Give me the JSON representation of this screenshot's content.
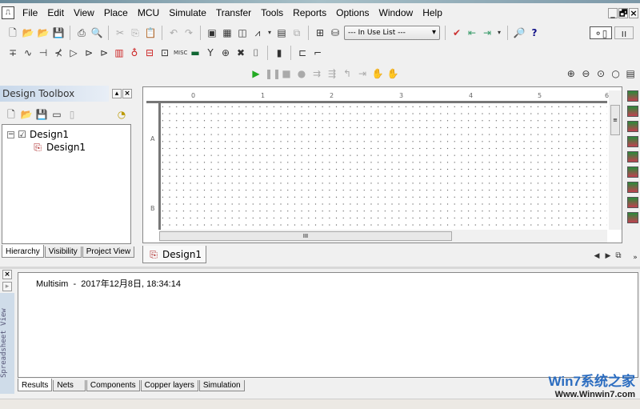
{
  "menu": [
    "File",
    "Edit",
    "View",
    "Place",
    "MCU",
    "Simulate",
    "Transfer",
    "Tools",
    "Reports",
    "Options",
    "Window",
    "Help"
  ],
  "window_controls": {
    "minimize": "_",
    "restore": "🗗",
    "close": "×"
  },
  "toolbar": {
    "in_use_list": "--- In Use List ---",
    "help": "?"
  },
  "components_toolbar": {
    "misc": "MISC"
  },
  "design_toolbox": {
    "title": "Design Toolbox",
    "tree": {
      "root": "Design1",
      "child": "Design1"
    },
    "tabs": [
      "Hierarchy",
      "Visibility",
      "Project View"
    ],
    "active_tab": "Hierarchy"
  },
  "canvas": {
    "ruler_top": [
      "0",
      "1",
      "2",
      "3",
      "4",
      "5",
      "6"
    ],
    "ruler_left": [
      "A",
      "B"
    ],
    "scroll_grip": "III",
    "tab": "Design1"
  },
  "output": {
    "message": "Multisim  -  2017年12月8日, 18:34:14",
    "side_label": "Spreadsheet View",
    "tabs": [
      "Results",
      "Nets",
      "Components",
      "Copper layers",
      "Simulation"
    ],
    "active_tab": "Results"
  },
  "watermark": {
    "brand": "Win7系统之家",
    "url": "Www.Winwin7.com"
  }
}
